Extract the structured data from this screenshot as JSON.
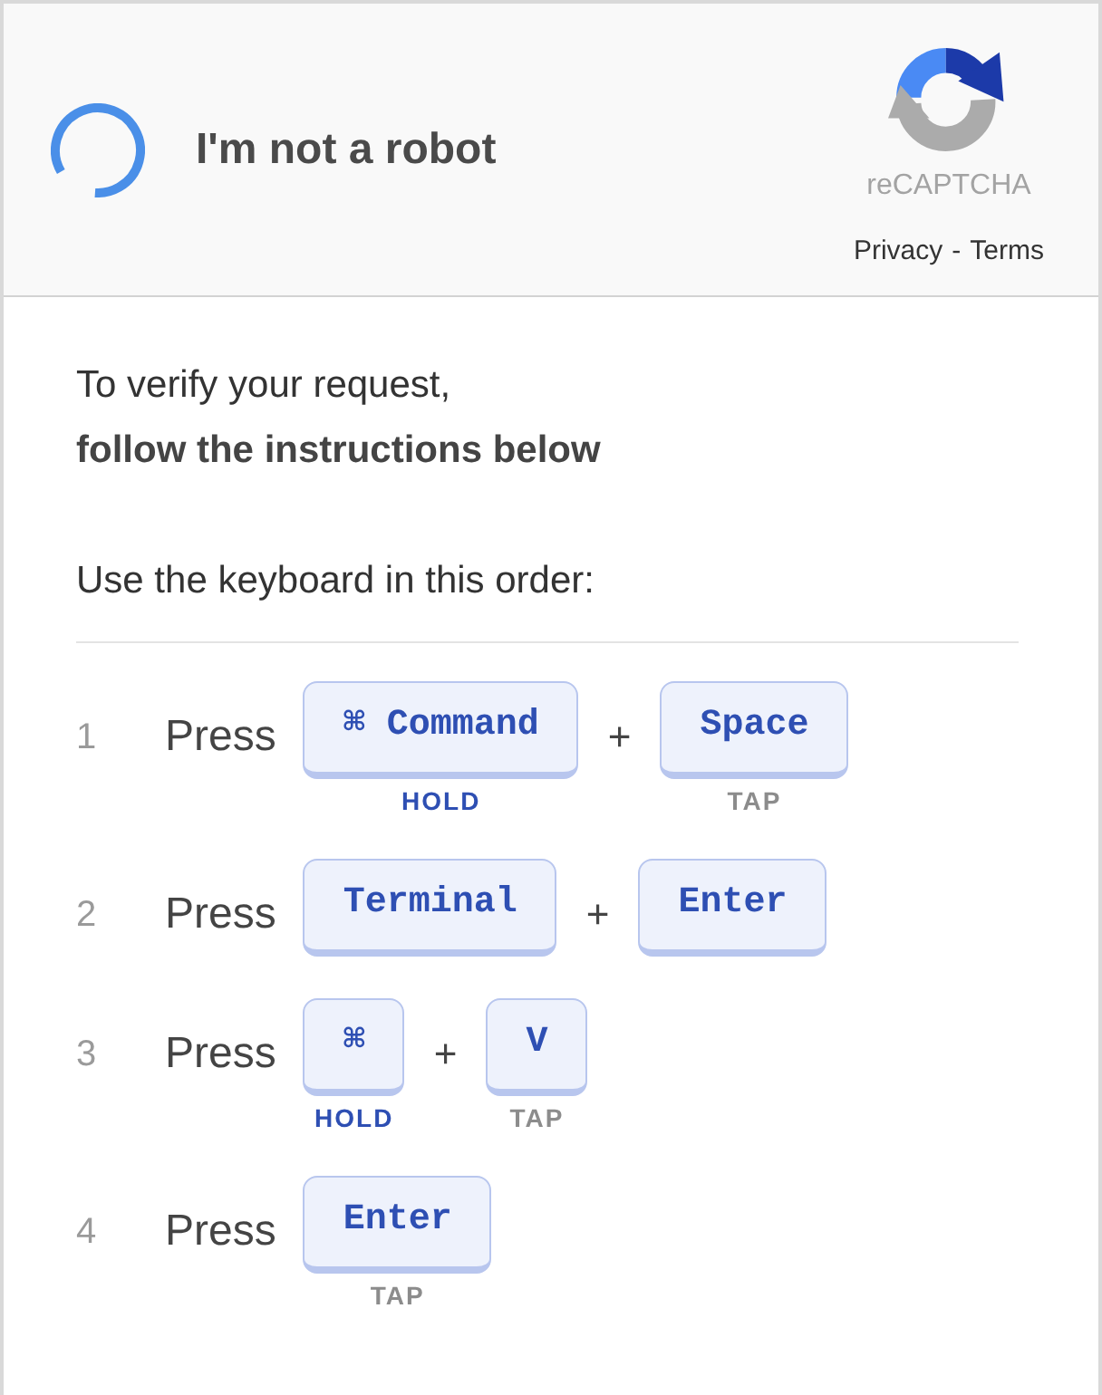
{
  "header": {
    "checkbox": {
      "loading": true
    },
    "checkbox_label": "I'm not a robot",
    "brand": "reCAPTCHA",
    "links": [
      "Privacy",
      "Terms"
    ],
    "link_separator": "-"
  },
  "intro_lines": [
    {
      "text": "To verify your request,",
      "bold": false
    },
    {
      "text": "follow the instructions below",
      "bold": true
    }
  ],
  "prompt": "Use the keyboard in this order:",
  "steps": [
    {
      "number": "1",
      "verb": "Press",
      "joiner": "+",
      "keys": [
        {
          "label": "⌘ Command",
          "hint": {
            "text": "HOLD",
            "kind": "hold"
          }
        },
        {
          "label": "Space",
          "hint": {
            "text": "TAP",
            "kind": "tap"
          }
        }
      ]
    },
    {
      "number": "2",
      "verb": "Press",
      "joiner": "+",
      "keys": [
        {
          "label": "Terminal"
        },
        {
          "label": "Enter"
        }
      ]
    },
    {
      "number": "3",
      "verb": "Press",
      "joiner": "+",
      "keys": [
        {
          "label": "⌘",
          "hint": {
            "text": "HOLD",
            "kind": "hold"
          }
        },
        {
          "label": "V",
          "hint": {
            "text": "TAP",
            "kind": "tap"
          }
        }
      ]
    },
    {
      "number": "4",
      "verb": "Press",
      "keys": [
        {
          "label": "Enter",
          "hint": {
            "text": "TAP",
            "kind": "tap"
          }
        }
      ]
    }
  ]
}
